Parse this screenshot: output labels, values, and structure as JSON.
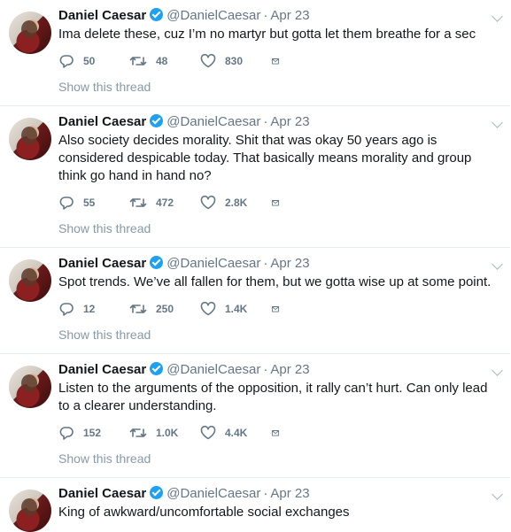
{
  "tweets": [
    {
      "name": "Daniel Caesar",
      "handle": "@DanielCaesar",
      "date": "Apr 23",
      "text": "Ima delete these, cuz I’m no martyr but gotta let them breathe for a sec",
      "replies": "50",
      "retweets": "48",
      "likes": "830",
      "show_thread": "Show this thread"
    },
    {
      "name": "Daniel Caesar",
      "handle": "@DanielCaesar",
      "date": "Apr 23",
      "text": "Also society decides morality. Shit that was okay 50 years ago is considered despicable today. That basically means morality and group think go hand in hand no?",
      "replies": "55",
      "retweets": "472",
      "likes": "2.8K",
      "show_thread": "Show this thread"
    },
    {
      "name": "Daniel Caesar",
      "handle": "@DanielCaesar",
      "date": "Apr 23",
      "text": "Spot trends. We’ve all fallen for them, but we gotta wise up at some point.",
      "replies": "12",
      "retweets": "250",
      "likes": "1.4K",
      "show_thread": "Show this thread"
    },
    {
      "name": "Daniel Caesar",
      "handle": "@DanielCaesar",
      "date": "Apr 23",
      "text": "Listen to the arguments of the opposition, it rally can’t hurt. Can only lead to a clearer understanding.",
      "replies": "152",
      "retweets": "1.0K",
      "likes": "4.4K",
      "show_thread": "Show this thread"
    },
    {
      "name": "Daniel Caesar",
      "handle": "@DanielCaesar",
      "date": "Apr 23",
      "text": "King of awkward/uncomfortable social exchanges"
    }
  ],
  "icons": {
    "reply": "reply-icon",
    "retweet": "retweet-icon",
    "like": "heart-icon",
    "dm": "envelope-icon",
    "verified": "verified-badge-icon",
    "caret": "chevron-down-icon"
  }
}
